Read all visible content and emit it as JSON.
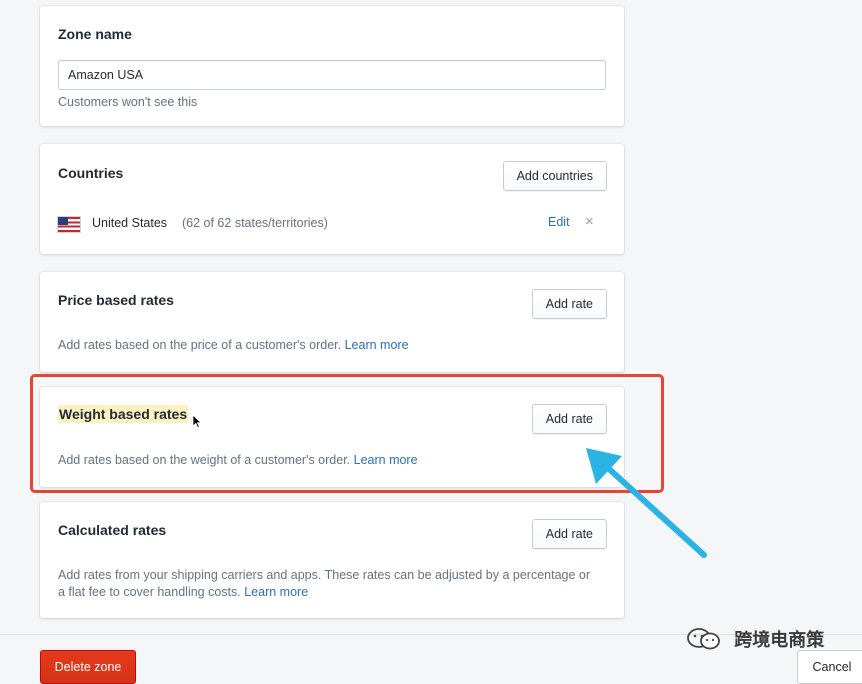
{
  "zone": {
    "title": "Zone name",
    "input_value": "Amazon USA",
    "help_text": "Customers won't see this"
  },
  "countries": {
    "title": "Countries",
    "add_button": "Add countries",
    "item": {
      "flag_icon": "us-flag-icon",
      "name": "United States",
      "detail": "(62 of 62 states/territories)",
      "edit_label": "Edit",
      "remove_label": "×"
    }
  },
  "price_rates": {
    "title": "Price based rates",
    "button": "Add rate",
    "help_text": "Add rates based on the price of a customer's order.",
    "learn_more": "Learn more"
  },
  "weight_rates": {
    "title": "Weight based rates",
    "button": "Add rate",
    "help_text": "Add rates based on the weight of a customer's order.",
    "learn_more": "Learn more"
  },
  "calculated_rates": {
    "title": "Calculated rates",
    "button": "Add rate",
    "help_line1": "Add rates from your shipping carriers and apps. These rates can be adjusted by a percentage or",
    "help_line2": "a flat fee to cover handling costs.",
    "learn_more": "Learn more"
  },
  "footer": {
    "delete_label": "Delete zone",
    "cancel_label": "Cancel"
  },
  "watermark": {
    "text": "跨境电商策",
    "icon": "wechat-icon"
  },
  "colors": {
    "annotation_box": "#e8452f",
    "annotation_arrow": "#2cb3e6",
    "link": "#2a6fbb",
    "danger": "#de3618"
  }
}
